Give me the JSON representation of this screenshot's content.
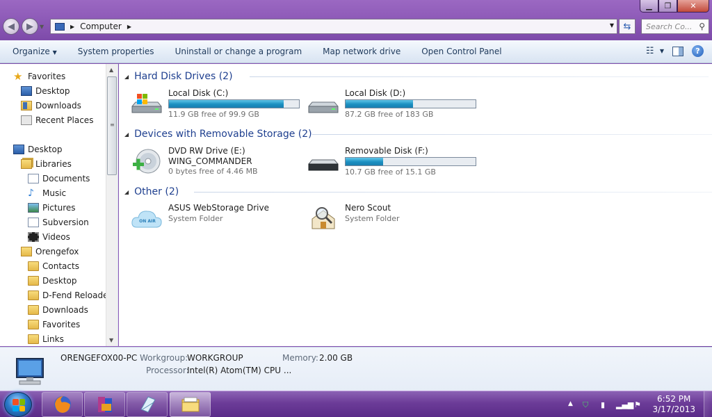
{
  "window": {
    "address_path": "Computer",
    "search_placeholder": "Search Co..."
  },
  "toolbar": {
    "organize": "Organize",
    "system_properties": "System properties",
    "uninstall": "Uninstall or change a program",
    "map_drive": "Map network drive",
    "control_panel": "Open Control Panel"
  },
  "nav": {
    "items": [
      {
        "label": "Favorites",
        "icon": "star-icon"
      },
      {
        "label": "Desktop",
        "icon": "desktop-icon"
      },
      {
        "label": "Downloads",
        "icon": "downloads-folder-icon"
      },
      {
        "label": "Recent Places",
        "icon": "recent-places-icon"
      },
      {
        "label": "Desktop",
        "icon": "desktop-icon"
      },
      {
        "label": "Libraries",
        "icon": "libraries-icon"
      },
      {
        "label": "Documents",
        "icon": "documents-icon"
      },
      {
        "label": "Music",
        "icon": "music-icon"
      },
      {
        "label": "Pictures",
        "icon": "pictures-icon"
      },
      {
        "label": "Subversion",
        "icon": "library-icon"
      },
      {
        "label": "Videos",
        "icon": "videos-icon"
      },
      {
        "label": "Orengefox",
        "icon": "user-folder-icon"
      },
      {
        "label": "Contacts",
        "icon": "folder-icon"
      },
      {
        "label": "Desktop",
        "icon": "folder-icon"
      },
      {
        "label": "D-Fend Reloaded",
        "icon": "folder-icon"
      },
      {
        "label": "Downloads",
        "icon": "folder-icon"
      },
      {
        "label": "Favorites",
        "icon": "folder-icon"
      },
      {
        "label": "Links",
        "icon": "folder-icon"
      }
    ]
  },
  "groups": {
    "hdd": "Hard Disk Drives (2)",
    "removable": "Devices with Removable Storage (2)",
    "other": "Other (2)"
  },
  "drives": {
    "c": {
      "name": "Local Disk (C:)",
      "free": "11.9 GB free of 99.9 GB",
      "used_fraction": 0.88
    },
    "d": {
      "name": "Local Disk (D:)",
      "free": "87.2 GB free of 183 GB",
      "used_fraction": 0.52
    },
    "e": {
      "name": "DVD RW Drive (E:)",
      "label": "WING_COMMANDER",
      "free": "0 bytes free of 4.46 MB"
    },
    "f": {
      "name": "Removable Disk (F:)",
      "free": "10.7 GB free of 15.1 GB",
      "used_fraction": 0.29
    }
  },
  "other": {
    "asus": {
      "name": "ASUS WebStorage Drive",
      "type": "System Folder",
      "badge": "ON AIR"
    },
    "nero": {
      "name": "Nero Scout",
      "type": "System Folder"
    }
  },
  "details": {
    "computer_name": "ORENGEFOX00-PC",
    "workgroup_label": "Workgroup:",
    "workgroup": "WORKGROUP",
    "memory_label": "Memory:",
    "memory": "2.00 GB",
    "processor_label": "Processor:",
    "processor": "Intel(R) Atom(TM) CPU ..."
  },
  "taskbar": {
    "apps": [
      "firefox-icon",
      "winrar-icon",
      "notepad-icon",
      "explorer-icon"
    ],
    "time": "6:52 PM",
    "date": "3/17/2013"
  },
  "colors": {
    "accent": "#1e3f8f",
    "bar_fill": "#1b8fc0",
    "titlebar": "#8a57b5"
  }
}
